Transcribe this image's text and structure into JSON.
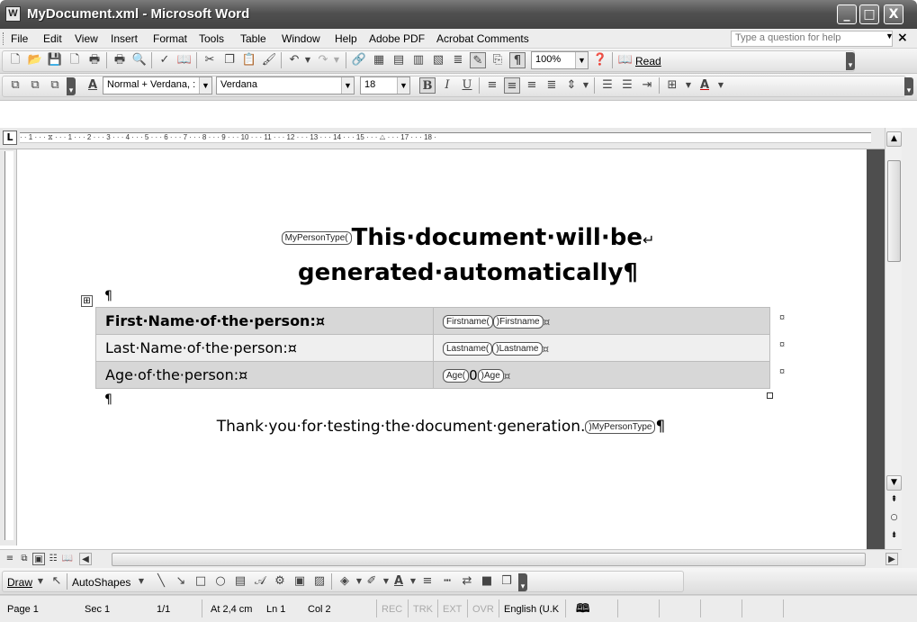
{
  "window": {
    "title": "MyDocument.xml - Microsoft Word",
    "app_icon": "W",
    "buttons": [
      "_",
      "□",
      "X"
    ]
  },
  "menubar": {
    "items": [
      "File",
      "Edit",
      "View",
      "Insert",
      "Format",
      "Tools",
      "Table",
      "Window",
      "Help",
      "Adobe PDF",
      "Acrobat Comments"
    ],
    "help_placeholder": "Type a question for help"
  },
  "standard_toolbar": {
    "zoom": "100%",
    "read_label": "Read"
  },
  "formatting_toolbar": {
    "style": "Normal + Verdana, :",
    "font": "Verdana",
    "size": "18"
  },
  "ruler": {
    "text": "· · 1 · · · ⧖ · · · 1 · · · 2 · · · 3 · · · 4 · · · 5 · · · 6 · · · 7 · · · 8 · · · 9 · · · 10 · · · 11 · · · 12 · · · 13 · · · 14 · · · 15 · · · △ · · · 17 · · · 18 ·"
  },
  "document": {
    "title_tag": "MyPersonType(",
    "title_line1": "This·document·will·be",
    "title_linebreak": "↵",
    "title_line2": "generated·automatically¶",
    "pilcrow": "¶",
    "table_move_handle": "⊞",
    "rows": [
      {
        "label": "First·Name·of·the·person:¤",
        "tag_open": "Firstname(",
        "value": "",
        "tag_close": ")Firstname",
        "cell_end": "¤",
        "row_end": "¤"
      },
      {
        "label": "Last·Name·of·the·person:¤",
        "tag_open": "Lastname(",
        "value": "",
        "tag_close": ")Lastname",
        "cell_end": "¤",
        "row_end": "¤"
      },
      {
        "label": "Age·of·the·person:¤",
        "tag_open": "Age(",
        "value": "0",
        "tag_close": ")Age",
        "cell_end": "¤",
        "row_end": "¤"
      }
    ],
    "closing_text": "Thank·you·for·testing·the·document·generation.",
    "closing_tag": ")MyPersonType",
    "closing_pilcrow": "¶"
  },
  "draw_toolbar": {
    "draw_label": "Draw",
    "autoshapes_label": "AutoShapes"
  },
  "statusbar": {
    "page": "Page 1",
    "section": "Sec 1",
    "page_of": "1/1",
    "at": "At 2,4 cm",
    "line": "Ln 1",
    "col": "Col 2",
    "rec": "REC",
    "trk": "TRK",
    "ext": "EXT",
    "ovr": "OVR",
    "language": "English (U.K"
  }
}
